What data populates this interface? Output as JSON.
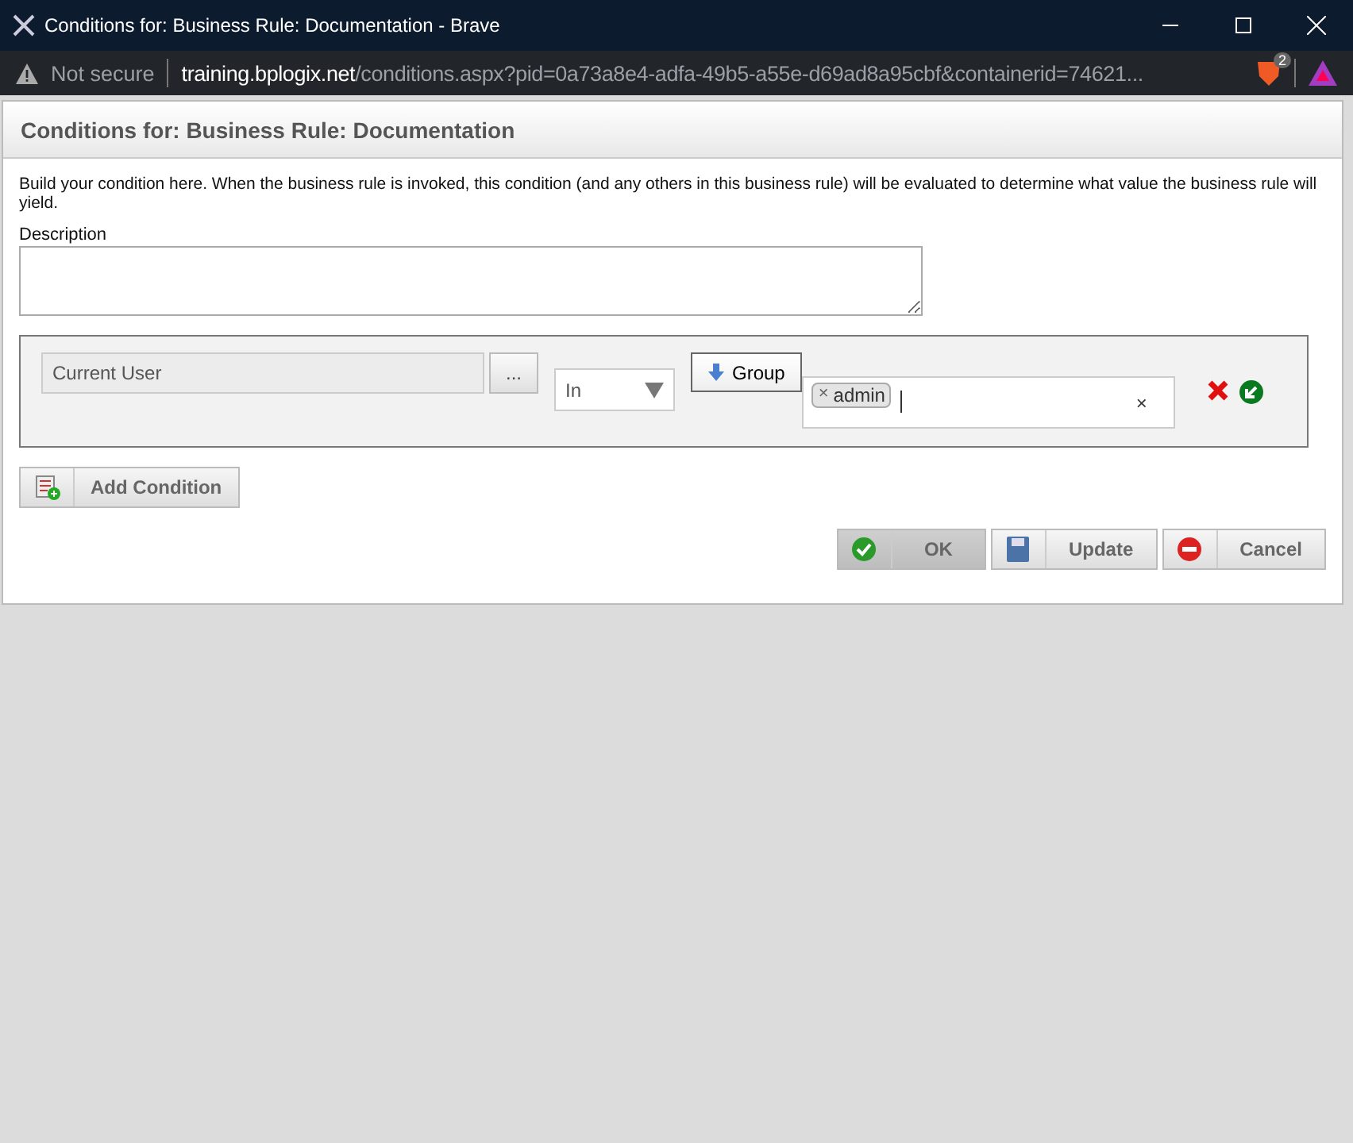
{
  "window": {
    "title": "Conditions for: Business Rule: Documentation - Brave"
  },
  "address_bar": {
    "security": "Not secure",
    "host": "training.bplogix.net",
    "path": "/conditions.aspx?pid=0a73a8e4-adfa-49b5-a55e-d69ad8a95cbf&containerid=74621...",
    "shields_count": "2"
  },
  "dialog": {
    "title": "Conditions for: Business Rule: Documentation",
    "intro": "Build your condition here. When the business rule is invoked, this condition (and any others in this business rule) will be evaluated to determine what value the business rule will yield.",
    "description_label": "Description",
    "condition": {
      "field": "Current User",
      "browse": "...",
      "operator": "In",
      "type_toggle": "Group",
      "tags": [
        {
          "label": "admin",
          "remove": "×"
        }
      ],
      "clear": "×"
    },
    "add_condition": "Add Condition",
    "buttons": [
      {
        "kind": "ok",
        "label": "OK",
        "disabled": true
      },
      {
        "kind": "update",
        "label": "Update",
        "disabled": false
      },
      {
        "kind": "cancel",
        "label": "Cancel",
        "disabled": false
      }
    ]
  }
}
